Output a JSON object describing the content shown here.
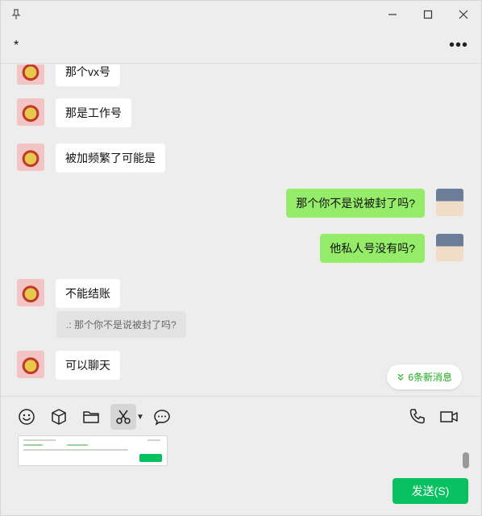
{
  "window": {
    "title": "*"
  },
  "icons": {
    "pin": "pin-icon",
    "minimize": "minimize-icon",
    "maximize": "maximize-icon",
    "close": "close-icon",
    "more": "more-icon"
  },
  "header": {
    "title": "*",
    "more_label": "•••"
  },
  "messages": [
    {
      "side": "left",
      "text": "那个vx号"
    },
    {
      "side": "left",
      "text": "那是工作号"
    },
    {
      "side": "left",
      "text": "被加频繁了可能是"
    },
    {
      "side": "right",
      "text": "那个你不是说被封了吗?"
    },
    {
      "side": "right",
      "text": "他私人号没有吗?"
    },
    {
      "side": "left",
      "text": "不能结账"
    },
    {
      "side": "left",
      "text": "可以聊天"
    }
  ],
  "quote": {
    "text": ".: 那个你不是说被封了吗?"
  },
  "new_messages": {
    "label": "6条新消息",
    "color": "#1aad19"
  },
  "toolbar": {
    "emoji": "emoji-icon",
    "sticker": "package-icon",
    "file": "folder-icon",
    "screenshot": "scissors-icon",
    "chat_history": "chat-bubble-icon",
    "voice_call": "phone-icon",
    "video_call": "video-icon"
  },
  "composer": {
    "send_label": "发送(S)",
    "send_color": "#07c160",
    "bubble_color_self": "#95ec69"
  }
}
